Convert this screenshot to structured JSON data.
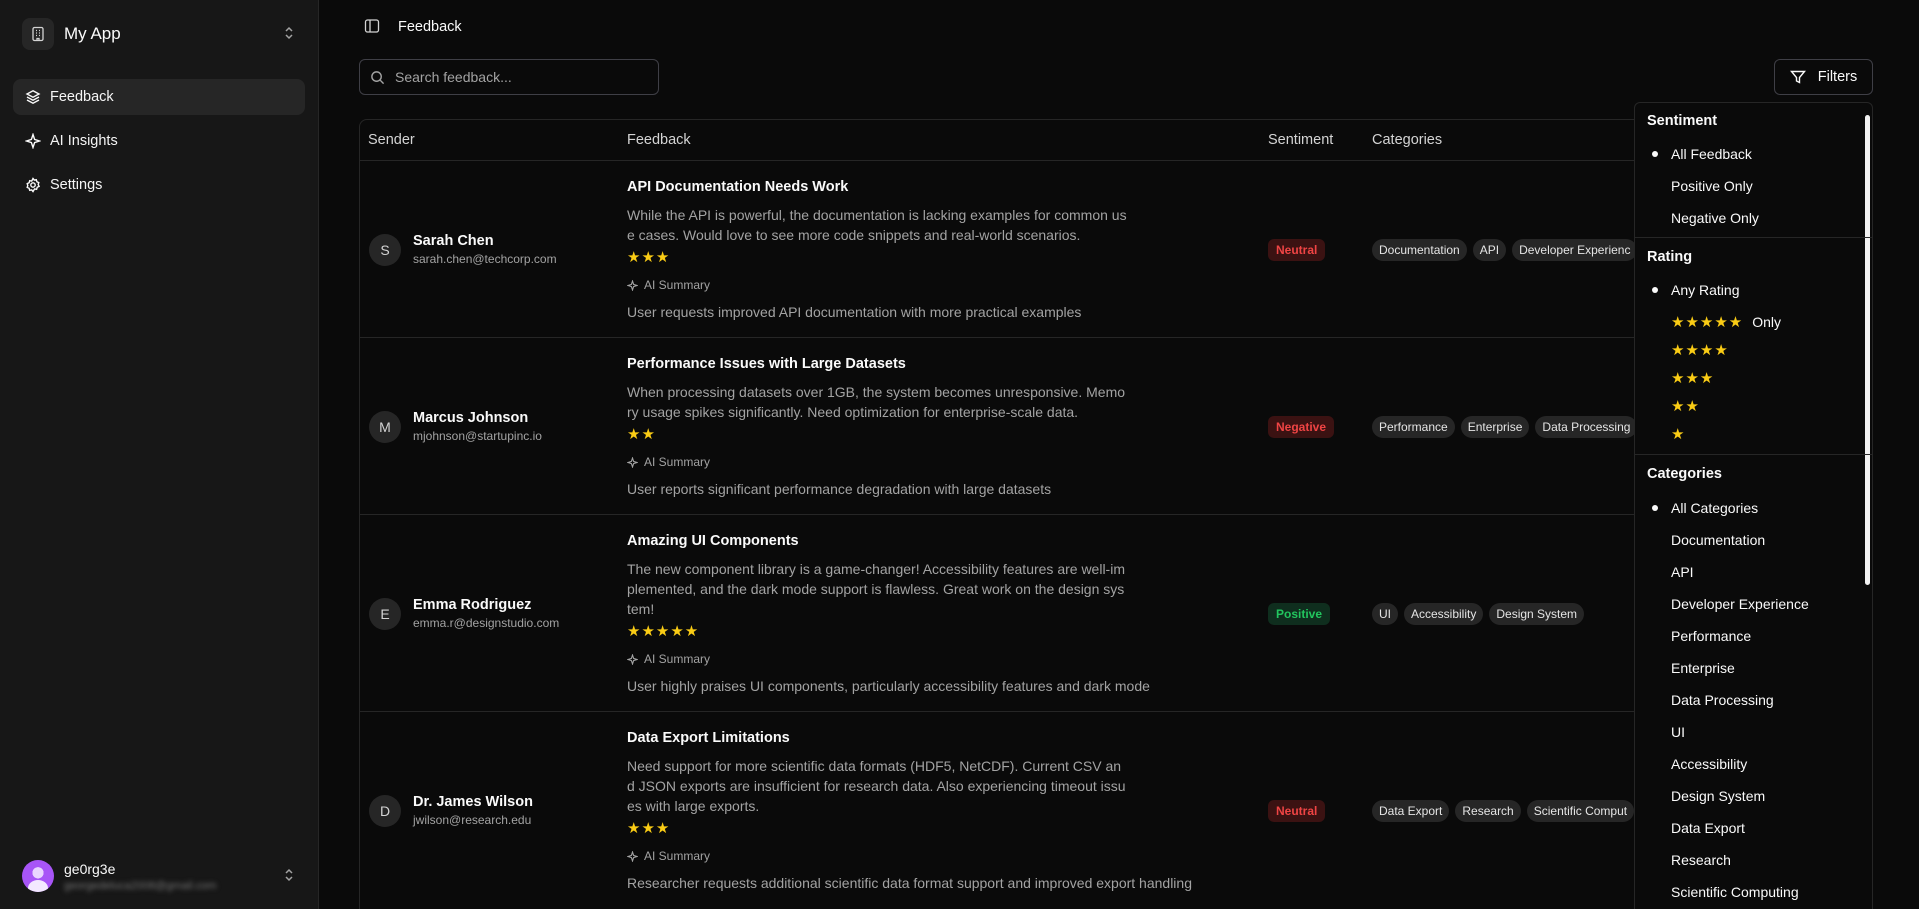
{
  "app": {
    "name": "My App"
  },
  "sidebar": {
    "items": [
      {
        "label": "Feedback",
        "icon": "layers-icon"
      },
      {
        "label": "AI Insights",
        "icon": "sparkles-icon"
      },
      {
        "label": "Settings",
        "icon": "gear-icon"
      }
    ]
  },
  "user": {
    "name": "ge0rg3e",
    "email": "georgedeluca2008@gmail.com"
  },
  "header": {
    "breadcrumb": "Feedback"
  },
  "search": {
    "placeholder": "Search feedback..."
  },
  "filters": {
    "label": "Filters"
  },
  "table": {
    "columns": [
      "Sender",
      "Feedback",
      "Sentiment",
      "Categories"
    ],
    "ai_summary_label": "AI Summary",
    "rows": [
      {
        "initial": "S",
        "name": "Sarah Chen",
        "email": "sarah.chen@techcorp.com",
        "title": "API Documentation Needs Work",
        "text": "While the API is powerful, the documentation is lacking examples for common use cases. Would love to see more code snippets and real-world scenarios.",
        "rating": 3,
        "summary": "User requests improved API documentation with more practical examples",
        "sentiment": "Neutral",
        "categories": [
          "Documentation",
          "API",
          "Developer Experienc"
        ]
      },
      {
        "initial": "M",
        "name": "Marcus Johnson",
        "email": "mjohnson@startupinc.io",
        "title": "Performance Issues with Large Datasets",
        "text": "When processing datasets over 1GB, the system becomes unresponsive. Memory usage spikes significantly. Need optimization for enterprise-scale data.",
        "rating": 2,
        "summary": "User reports significant performance degradation with large datasets",
        "sentiment": "Negative",
        "categories": [
          "Performance",
          "Enterprise",
          "Data Processing"
        ]
      },
      {
        "initial": "E",
        "name": "Emma Rodriguez",
        "email": "emma.r@designstudio.com",
        "title": "Amazing UI Components",
        "text": "The new component library is a game-changer! Accessibility features are well-implemented, and the dark mode support is flawless. Great work on the design system!",
        "rating": 5,
        "summary": "User highly praises UI components, particularly accessibility features and dark mode",
        "sentiment": "Positive",
        "categories": [
          "UI",
          "Accessibility",
          "Design System"
        ]
      },
      {
        "initial": "D",
        "name": "Dr. James Wilson",
        "email": "jwilson@research.edu",
        "title": "Data Export Limitations",
        "text": "Need support for more scientific data formats (HDF5, NetCDF). Current CSV and JSON exports are insufficient for research data. Also experiencing timeout issues with large exports.",
        "rating": 3,
        "summary": "Researcher requests additional scientific data format support and improved export handling",
        "sentiment": "Neutral",
        "categories": [
          "Data Export",
          "Research",
          "Scientific Comput"
        ]
      }
    ]
  },
  "dropdown": {
    "sentiment_label": "Sentiment",
    "sentiment_options": [
      "All Feedback",
      "Positive Only",
      "Negative Only"
    ],
    "sentiment_selected": "All Feedback",
    "rating_label": "Rating",
    "rating_any": "Any Rating",
    "rating_only_suffix": "Only",
    "rating_levels": [
      5,
      4,
      3,
      2,
      1
    ],
    "categories_label": "Categories",
    "category_options": [
      "All Categories",
      "Documentation",
      "API",
      "Developer Experience",
      "Performance",
      "Enterprise",
      "Data Processing",
      "UI",
      "Accessibility",
      "Design System",
      "Data Export",
      "Research",
      "Scientific Computing"
    ],
    "category_selected": "All Categories"
  },
  "colors": {
    "star": "#facc15",
    "negative": "#ef4444",
    "positive": "#22c55e",
    "background": "#0a0a0a",
    "sidebar": "#171717"
  }
}
